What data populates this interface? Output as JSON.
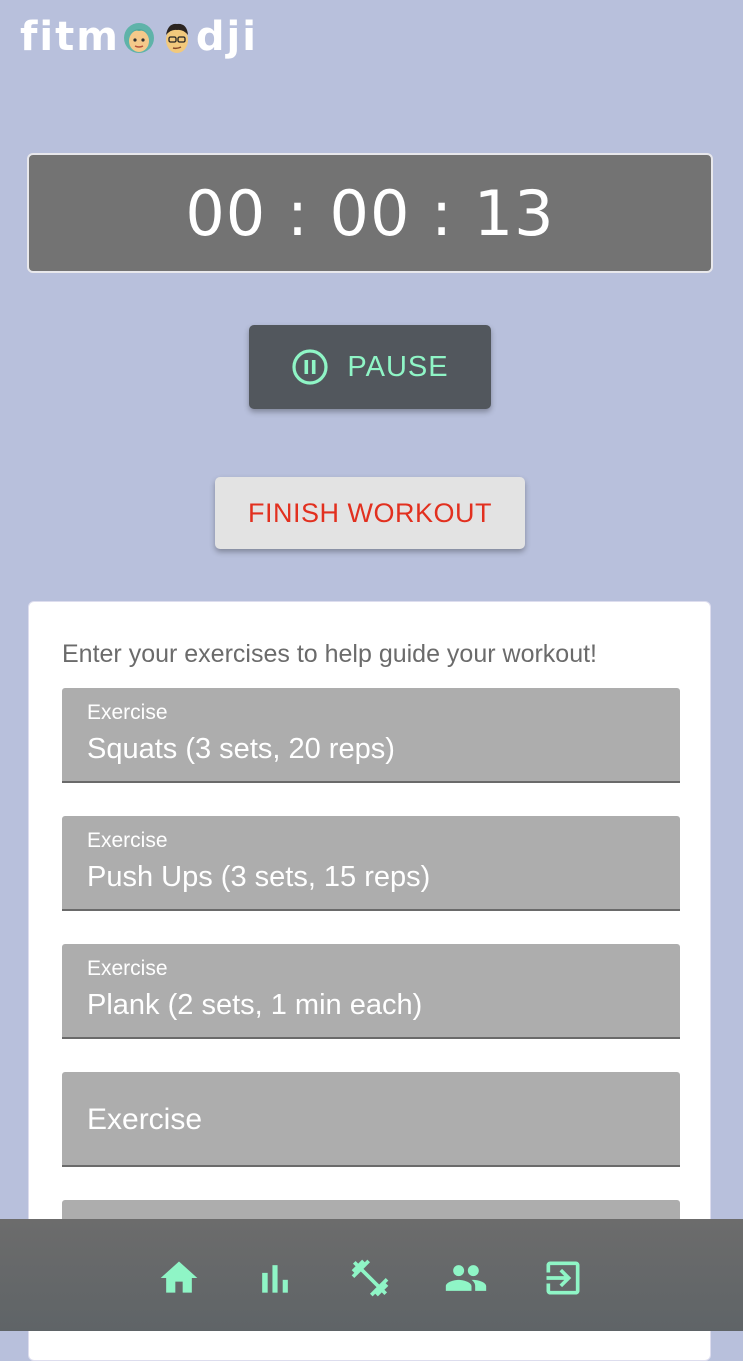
{
  "app": {
    "logo_left": "fitm",
    "logo_right": "dji"
  },
  "timer": {
    "display": "00 : 00 : 13"
  },
  "controls": {
    "pause_label": "PAUSE",
    "finish_label": "FINISH WORKOUT"
  },
  "exercises": {
    "intro": "Enter your exercises to help guide your workout!",
    "fields": [
      {
        "label": "Exercise",
        "value": "Squats (3 sets, 20 reps)"
      },
      {
        "label": "Exercise",
        "value": "Push Ups (3 sets, 15 reps)"
      },
      {
        "label": "Exercise",
        "value": "Plank (2 sets, 1 min each)"
      },
      {
        "label": "Exercise",
        "value": ""
      }
    ]
  },
  "nav": {
    "items": [
      "home-icon",
      "bar-chart-icon",
      "dumbbell-icon",
      "people-icon",
      "exit-icon"
    ]
  },
  "colors": {
    "background": "#b8c0dc",
    "accent": "#8ff5c6",
    "finish_text": "#e2301f",
    "timer_bg": "#737373"
  }
}
